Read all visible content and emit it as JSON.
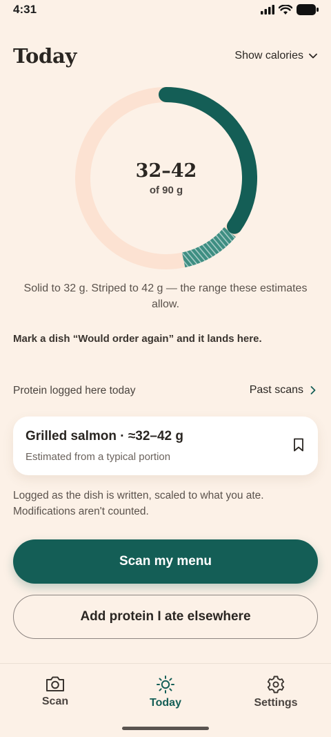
{
  "status": {
    "time": "4:31"
  },
  "header": {
    "title": "Today",
    "toggle_label": "Show calories"
  },
  "ring": {
    "value_text": "32–42",
    "of_text": "of 90 g",
    "goal_g": 90,
    "solid_g": 32,
    "striped_g": 42,
    "caption": "Solid to 32 g. Striped to 42 g — the range these estimates allow.",
    "colors": {
      "track": "#FCE2D2",
      "fill": "#145E56",
      "stripe": "#3E8E82"
    }
  },
  "promo_text": "Mark a dish “Would order again” and it lands here.",
  "logged": {
    "section_label": "Protein logged here today",
    "past_link": "Past scans",
    "card": {
      "title": "Grilled salmon · ≈32–42 g",
      "subtitle": "Estimated from a typical portion",
      "icon": "bookmark-icon"
    },
    "note": "Logged as the dish is written, scaled to what you ate. Modifications aren't counted."
  },
  "actions": {
    "primary": "Scan my menu",
    "secondary": "Add protein I ate elsewhere"
  },
  "tabs": [
    {
      "label": "Scan",
      "icon": "camera-icon"
    },
    {
      "label": "Today",
      "icon": "sun-icon",
      "active": true
    },
    {
      "label": "Settings",
      "icon": "gear-icon"
    }
  ]
}
